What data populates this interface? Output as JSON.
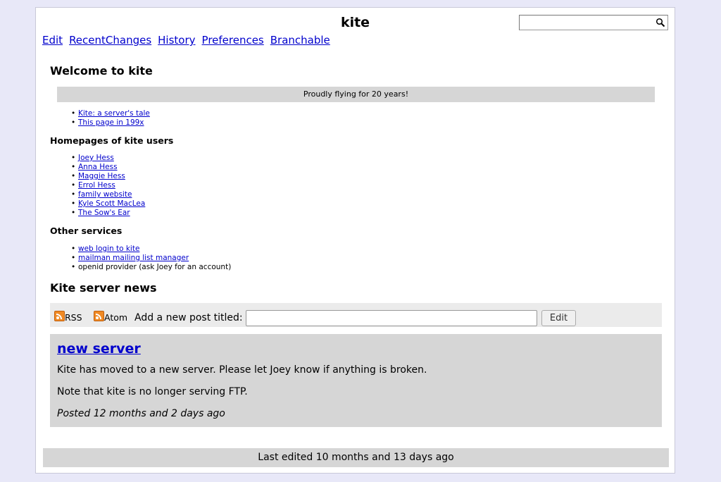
{
  "site_title": "kite",
  "search": {
    "placeholder": ""
  },
  "actions": [
    "Edit",
    "RecentChanges",
    "History",
    "Preferences",
    "Branchable"
  ],
  "welcome_heading": "Welcome to kite",
  "banner": "Proudly flying for 20 years!",
  "intro_links": [
    "Kite: a server's tale",
    "This page in 199x"
  ],
  "homepages_heading": "Homepages of kite users",
  "homepages": [
    "Joey Hess",
    "Anna Hess",
    "Maggie Hess",
    "Errol Hess",
    "family website",
    "Kyle Scott MacLea",
    "The Sow's Ear"
  ],
  "services_heading": "Other services",
  "services": {
    "link1": "web login to kite",
    "link2": "mailman mailing list manager",
    "text3": "openid provider (ask Joey for an account)"
  },
  "news_heading": "Kite server news",
  "postbar": {
    "rss_label": "RSS",
    "atom_label": "Atom",
    "add_label": "Add a new post titled:",
    "title_value": "",
    "edit_button": "Edit"
  },
  "post": {
    "title": "new server",
    "body1": "Kite has moved to a new server. Please let Joey know if anything is broken.",
    "body2": "Note that kite is no longer serving FTP.",
    "posted": "Posted 12 months and 2 days ago"
  },
  "footer": "Last edited 10 months and 13 days ago",
  "colors": {
    "background": "#e8e8f8",
    "link": "#0000cc",
    "panel": "#d6d6d6",
    "rss": "#f08a24"
  }
}
